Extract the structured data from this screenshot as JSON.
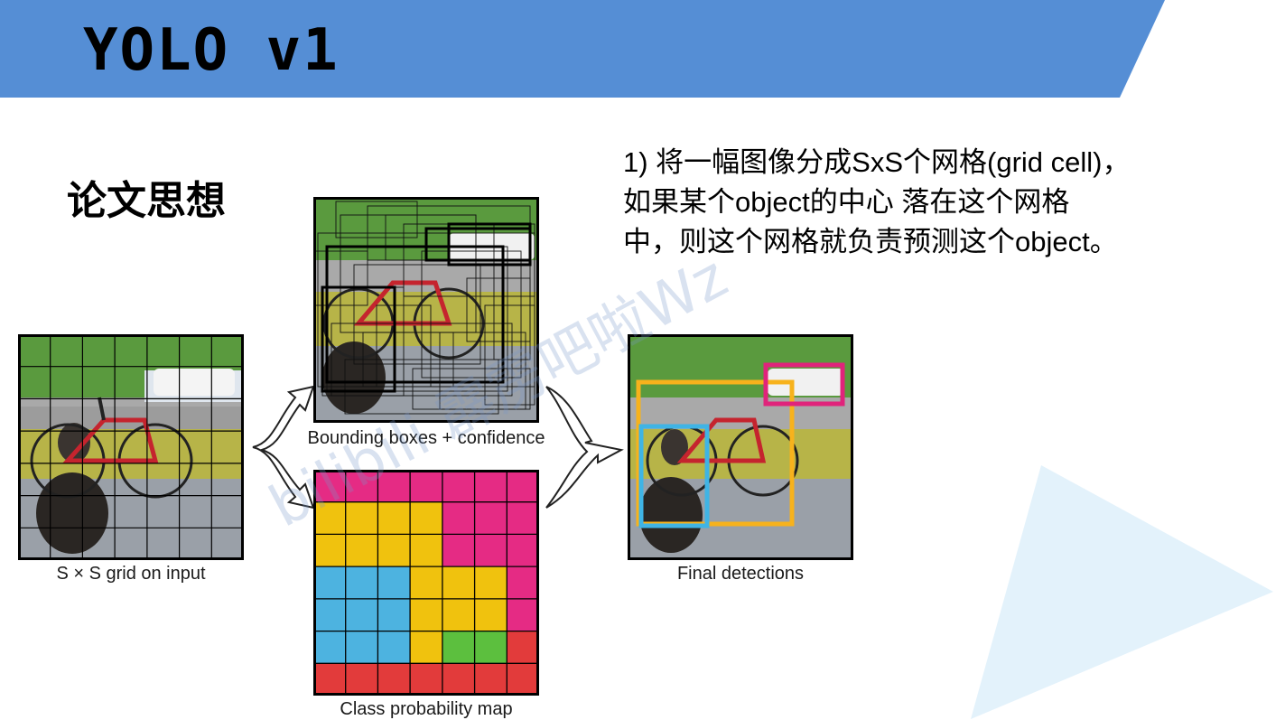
{
  "slide": {
    "title": "YOLO v1",
    "subtitle": "论文思想",
    "description_lines": [
      "1) 将一幅图像分成SxS个网格(grid cell)，",
      "如果某个object的中心 落在这个网格",
      "中，则这个网格就负责预测这个object。"
    ]
  },
  "figure": {
    "captions": {
      "input": "S × S grid on input",
      "boxes": "Bounding boxes + confidence",
      "classmap": "Class probability map",
      "final": "Final detections"
    }
  },
  "watermark": "bilibili 霹雳吧啦Wz",
  "colors": {
    "banner": "#558ed5",
    "triangle": "#dff0fa",
    "class_pink": "#e52b84",
    "class_yellow": "#f0c20e",
    "class_blue": "#4db3e0",
    "class_green": "#5cbf3e",
    "class_red": "#e23b3b",
    "det_orange": "#f7b21c",
    "det_cyan": "#3fb4e5",
    "det_magenta": "#e0247b"
  }
}
